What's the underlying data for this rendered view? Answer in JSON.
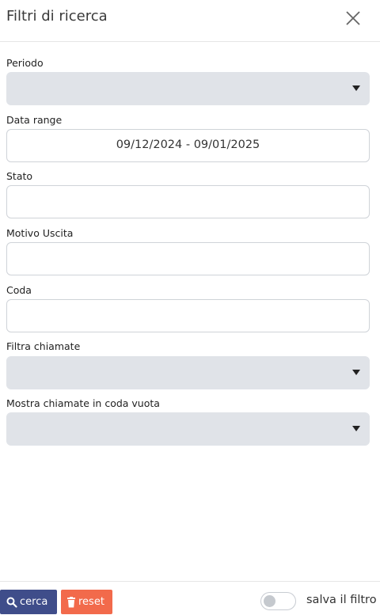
{
  "panel": {
    "title": "Filtri di ricerca",
    "close_icon": "close-icon"
  },
  "fields": {
    "periodo": {
      "label": "Periodo",
      "value": ""
    },
    "data_range": {
      "label": "Data range",
      "value": "09/12/2024 - 09/01/2025"
    },
    "stato": {
      "label": "Stato",
      "value": ""
    },
    "motivo_uscita": {
      "label": "Motivo Uscita",
      "value": ""
    },
    "coda": {
      "label": "Coda",
      "value": ""
    },
    "filtra_chiamate": {
      "label": "Filtra chiamate",
      "value": ""
    },
    "mostra_coda_vuota": {
      "label": "Mostra chiamate in coda vuota",
      "value": ""
    }
  },
  "footer": {
    "search_label": "cerca",
    "reset_label": "reset",
    "save_filter_label": "salva il filtro",
    "save_filter_on": false
  },
  "colors": {
    "search_button": "#3f4d8a",
    "reset_button": "#f26a4b",
    "select_bg": "#e0e3e8"
  }
}
